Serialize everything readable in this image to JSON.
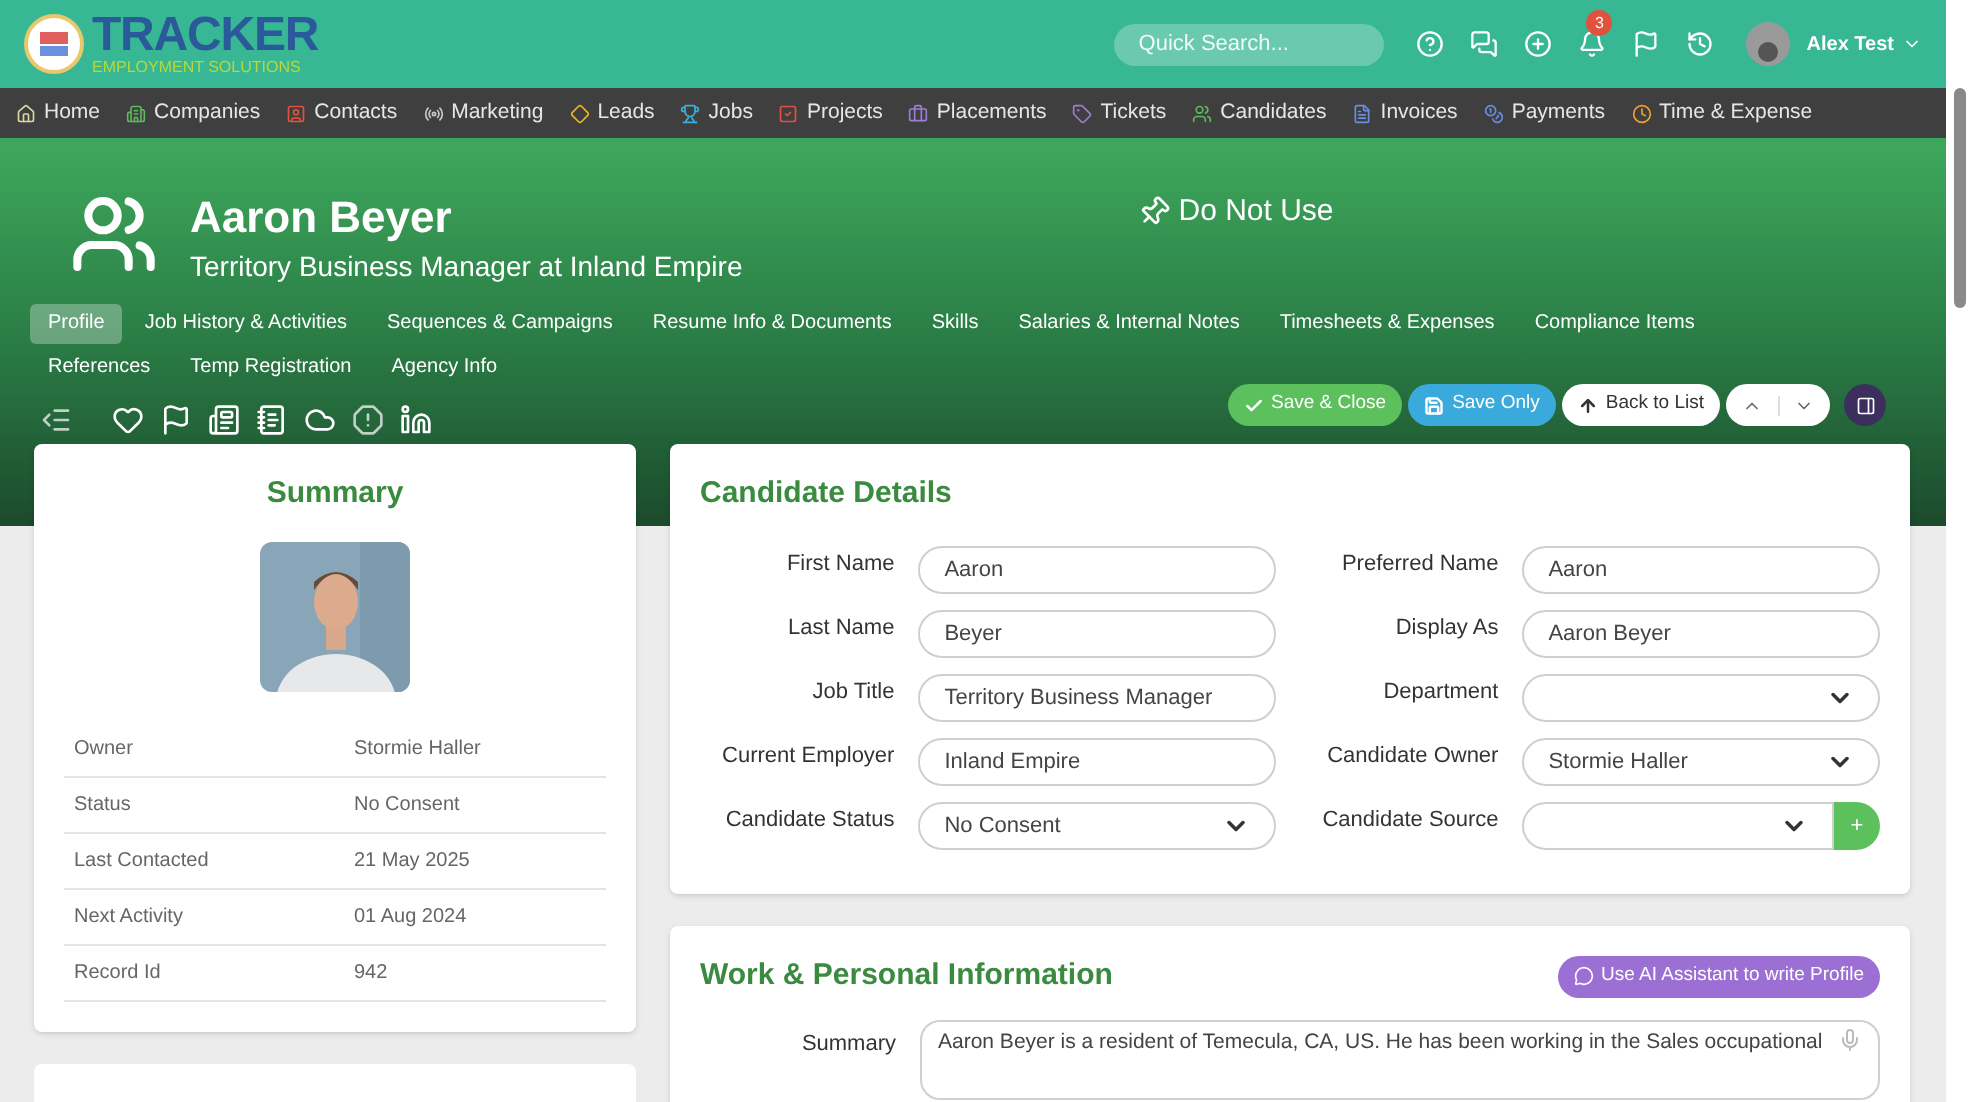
{
  "brand": {
    "name": "TRACKER",
    "tagline": "EMPLOYMENT SOLUTIONS"
  },
  "search": {
    "placeholder": "Quick Search..."
  },
  "notifications": {
    "count": "3"
  },
  "user": {
    "name": "Alex Test"
  },
  "nav": [
    {
      "label": "Home",
      "color": "#d9d9a0"
    },
    {
      "label": "Companies",
      "color": "#5cb85c"
    },
    {
      "label": "Contacts",
      "color": "#e0523e"
    },
    {
      "label": "Marketing",
      "color": "#c8c8c8"
    },
    {
      "label": "Leads",
      "color": "#f0b429"
    },
    {
      "label": "Jobs",
      "color": "#3ab0e0"
    },
    {
      "label": "Projects",
      "color": "#e0523e"
    },
    {
      "label": "Placements",
      "color": "#9b7fd4"
    },
    {
      "label": "Tickets",
      "color": "#9b7fd4"
    },
    {
      "label": "Candidates",
      "color": "#5cb85c"
    },
    {
      "label": "Invoices",
      "color": "#6b8fe0"
    },
    {
      "label": "Payments",
      "color": "#6b8fe0"
    },
    {
      "label": "Time & Expense",
      "color": "#f0a030"
    }
  ],
  "record": {
    "name": "Aaron Beyer",
    "subtitle": "Territory Business Manager at Inland Empire",
    "flag": "Do Not Use"
  },
  "tabs": [
    {
      "label": "Profile",
      "selected": true
    },
    {
      "label": "Job History & Activities",
      "selected": false
    },
    {
      "label": "Sequences & Campaigns",
      "selected": false
    },
    {
      "label": "Resume Info & Documents",
      "selected": false
    },
    {
      "label": "Skills",
      "selected": false
    },
    {
      "label": "Salaries & Internal Notes",
      "selected": false
    },
    {
      "label": "Timesheets & Expenses",
      "selected": false
    },
    {
      "label": "Compliance Items",
      "selected": false
    },
    {
      "label": "References",
      "selected": false
    },
    {
      "label": "Temp Registration",
      "selected": false
    },
    {
      "label": "Agency Info",
      "selected": false
    }
  ],
  "actions": [
    {
      "label": "Save & Close",
      "kind": "save_close"
    },
    {
      "label": "Save Only",
      "kind": "save"
    },
    {
      "label": "Back to List",
      "kind": "back"
    }
  ],
  "summary": {
    "title": "Summary",
    "rows": [
      {
        "label": "Owner",
        "value": "Stormie Haller"
      },
      {
        "label": "Status",
        "value": "No Consent"
      },
      {
        "label": "Last Contacted",
        "value": "21 May 2025"
      },
      {
        "label": "Next Activity",
        "value": "01 Aug 2024"
      },
      {
        "label": "Record Id",
        "value": "942"
      }
    ]
  },
  "details": {
    "title": "Candidate Details",
    "fields": [
      {
        "label": "First Name",
        "value": "Aaron",
        "kind": "text"
      },
      {
        "label": "Preferred Name",
        "value": "Aaron",
        "kind": "text"
      },
      {
        "label": "Last Name",
        "value": "Beyer",
        "kind": "text"
      },
      {
        "label": "Display As",
        "value": "Aaron Beyer",
        "kind": "text"
      },
      {
        "label": "Job Title",
        "value": "Territory Business Manager",
        "kind": "text"
      },
      {
        "label": "Department",
        "kind": "select"
      },
      {
        "label": "Current Employer",
        "value": "Inland Empire",
        "kind": "text"
      },
      {
        "label": "Candidate Owner",
        "value": "Stormie Haller",
        "kind": "select"
      },
      {
        "label": "Candidate Status",
        "value": "No Consent",
        "kind": "select"
      },
      {
        "label": "Candidate Source",
        "kind": "select_add",
        "add": "+"
      }
    ]
  },
  "work": {
    "title": "Work & Personal Information",
    "ai_button": "Use AI Assistant to write Profile",
    "summary_label": "Summary",
    "summary": "Aaron Beyer is a resident of Temecula, CA, US. He has been working in the Sales occupational"
  }
}
